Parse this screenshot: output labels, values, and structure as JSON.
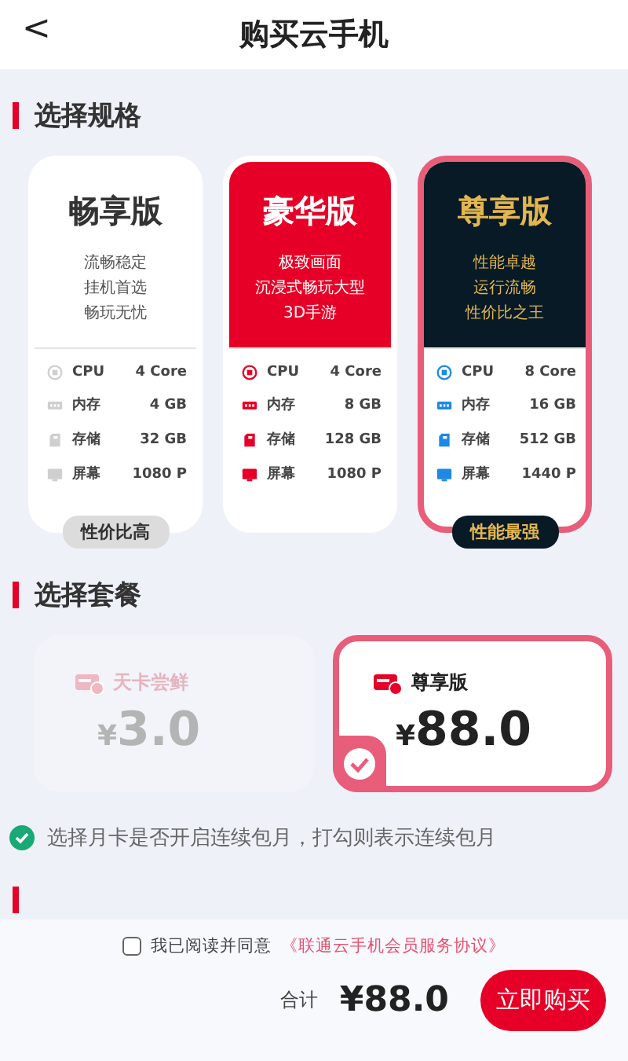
{
  "header": {
    "back": "<",
    "title": "购买云手机"
  },
  "spec_section": {
    "title": "选择规格"
  },
  "tiers": [
    {
      "kind": "basic",
      "selected": false,
      "name": "畅享版",
      "features": [
        "流畅稳定",
        "挂机首选",
        "畅玩无忧"
      ],
      "specs": [
        {
          "kind": "cpu",
          "label": "CPU",
          "value": "4 Core"
        },
        {
          "kind": "ram",
          "label": "内存",
          "value": "4 GB"
        },
        {
          "kind": "storage",
          "label": "存储",
          "value": "32 GB"
        },
        {
          "kind": "screen",
          "label": "屏幕",
          "value": "1080 P"
        }
      ],
      "badge": "性价比高"
    },
    {
      "kind": "deluxe",
      "selected": false,
      "name": "豪华版",
      "features": [
        "极致画面",
        "沉浸式畅玩大型",
        "3D手游"
      ],
      "specs": [
        {
          "kind": "cpu",
          "label": "CPU",
          "value": "4 Core"
        },
        {
          "kind": "ram",
          "label": "内存",
          "value": "8 GB"
        },
        {
          "kind": "storage",
          "label": "存储",
          "value": "128 GB"
        },
        {
          "kind": "screen",
          "label": "屏幕",
          "value": "1080 P"
        }
      ]
    },
    {
      "kind": "premium",
      "selected": true,
      "name": "尊享版",
      "features": [
        "性能卓越",
        "运行流畅",
        "性价比之王"
      ],
      "specs": [
        {
          "kind": "cpu",
          "label": "CPU",
          "value": "8 Core"
        },
        {
          "kind": "ram",
          "label": "内存",
          "value": "16 GB"
        },
        {
          "kind": "storage",
          "label": "存储",
          "value": "512 GB"
        },
        {
          "kind": "screen",
          "label": "屏幕",
          "value": "1440 P"
        }
      ],
      "badge": "性能最强"
    }
  ],
  "plan_section": {
    "title": "选择套餐"
  },
  "plans": [
    {
      "name": "天卡尝鲜",
      "currency": "¥",
      "price": "3.0",
      "selected": false
    },
    {
      "name": "尊享版",
      "currency": "¥",
      "price": "88.0",
      "selected": true
    }
  ],
  "note": {
    "checked": true,
    "text": "选择月卡是否开启连续包月，打勾则表示连续包月"
  },
  "footer": {
    "agree_checked": false,
    "agree_text": "我已阅读并同意",
    "agreement_link": "《联通云手机会员服务协议》",
    "total_label": "合计",
    "total": "¥88.0",
    "buy_button": "立即购买"
  }
}
